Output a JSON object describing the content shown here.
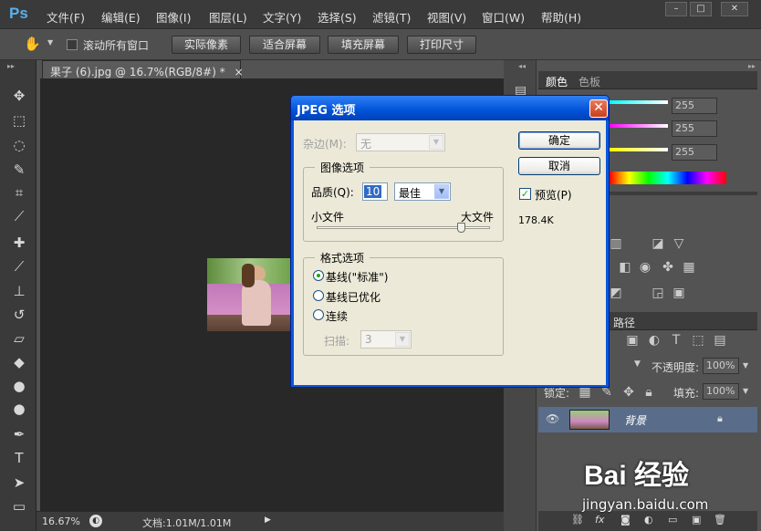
{
  "app": {
    "logo": "Ps",
    "menus": [
      "文件(F)",
      "编辑(E)",
      "图像(I)",
      "图层(L)",
      "文字(Y)",
      "选择(S)",
      "滤镜(T)",
      "视图(V)",
      "窗口(W)",
      "帮助(H)"
    ],
    "window_controls": [
      "–",
      "□",
      "✕"
    ]
  },
  "options_bar": {
    "scroll_all_windows": "滚动所有窗口",
    "scroll_all_checked": false,
    "buttons": [
      "实际像素",
      "适合屏幕",
      "填充屏幕",
      "打印尺寸"
    ]
  },
  "document": {
    "tab_title": "果子 (6).jpg @ 16.7%(RGB/8#) *",
    "close": "×",
    "zoom": "16.67%",
    "doc_info": "文档:1.01M/1.01M"
  },
  "tools": [
    "move-icon",
    "marquee-icon",
    "lasso-icon",
    "quick-select-icon",
    "crop-icon",
    "eyedropper-icon",
    "healing-icon",
    "brush-icon",
    "stamp-icon",
    "history-brush-icon",
    "eraser-icon",
    "bucket-icon",
    "blur-icon",
    "dodge-icon",
    "pen-icon",
    "type-icon",
    "path-select-icon",
    "rectangle-icon"
  ],
  "color_panel": {
    "tabs": [
      "颜色",
      "色板"
    ],
    "values": [
      "255",
      "255",
      "255"
    ]
  },
  "layers_panel": {
    "tab_paths": "路径",
    "opacity_label": "不透明度:",
    "opacity_value": "100%",
    "lock_label": "锁定:",
    "fill_label": "填充:",
    "fill_value": "100%",
    "layer_name": "背景"
  },
  "dialog": {
    "title": "JPEG 选项",
    "matte_label": "杂边(M):",
    "matte_value": "无",
    "image_options_group": "图像选项",
    "quality_label": "品质(Q):",
    "quality_value": "10",
    "quality_preset": "最佳",
    "small_file": "小文件",
    "large_file": "大文件",
    "quality_slider_fraction": 0.83,
    "format_options_group": "格式选项",
    "format_options": [
      "基线(\"标准\")",
      "基线已优化",
      "连续"
    ],
    "format_selected": 0,
    "scans_label": "扫描:",
    "scans_value": "3",
    "ok_button": "确定",
    "cancel_button": "取消",
    "preview_label": "预览(P)",
    "preview_checked": true,
    "file_size": "178.4K"
  },
  "watermark": {
    "brand": "Bai 经验",
    "url": "jingyan.baidu.com"
  }
}
